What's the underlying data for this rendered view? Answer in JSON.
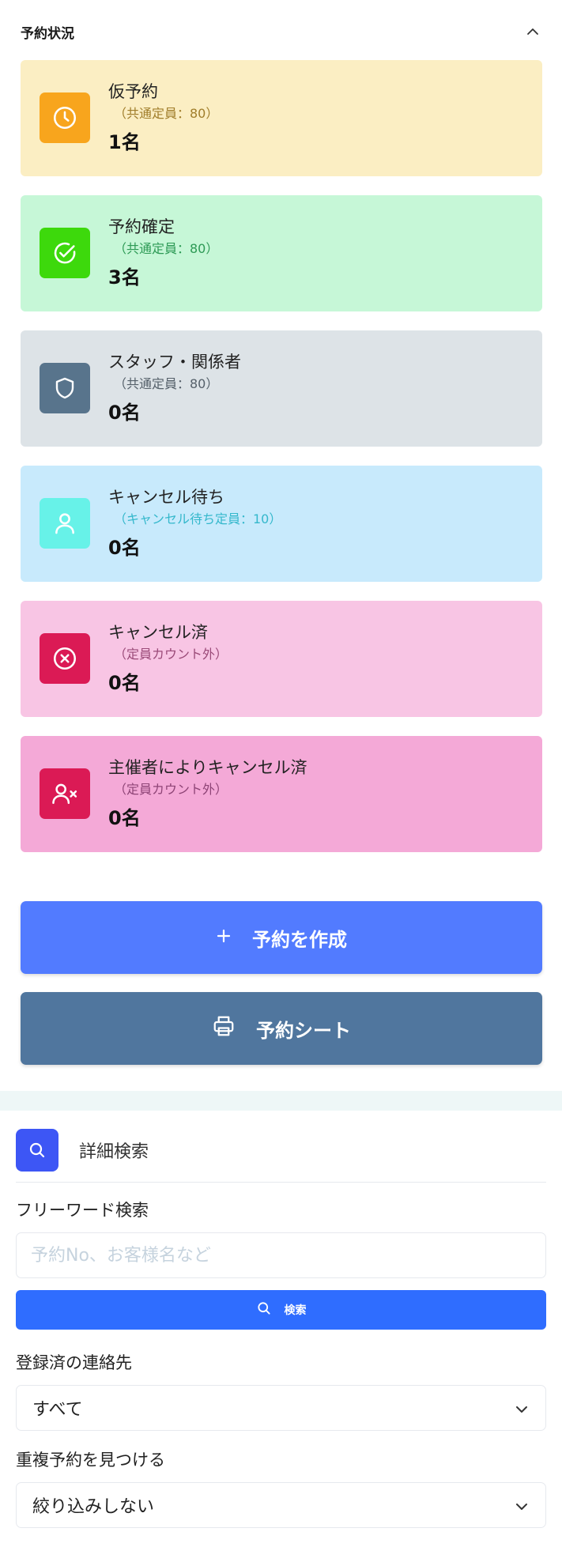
{
  "status_panel": {
    "title": "予約状況",
    "cards": [
      {
        "title": "仮予約",
        "subtitle": "（共通定員：80）",
        "count": "1名",
        "icon": "clock-icon",
        "bg": "#fbeec3",
        "icon_bg": "#f8a51d",
        "sub_color": "#a07d2a"
      },
      {
        "title": "予約確定",
        "subtitle": "（共通定員：80）",
        "count": "3名",
        "icon": "check-circle-icon",
        "bg": "#c6f7d7",
        "icon_bg": "#3dd90c",
        "sub_color": "#2d9a55"
      },
      {
        "title": "スタッフ・関係者",
        "subtitle": "（共通定員：80）",
        "count": "0名",
        "icon": "shield-icon",
        "bg": "#dde3e7",
        "icon_bg": "#58748c",
        "sub_color": "#55606a"
      },
      {
        "title": "キャンセル待ち",
        "subtitle": "（キャンセル待ち定員：10）",
        "count": "0名",
        "icon": "user-icon",
        "bg": "#c8eafc",
        "icon_bg": "#67f2e8",
        "sub_color": "#35b8cc"
      },
      {
        "title": "キャンセル済",
        "subtitle": "（定員カウント外）",
        "count": "0名",
        "icon": "x-circle-icon",
        "bg": "#f8c5e4",
        "icon_bg": "#db1a55",
        "sub_color": "#9a4a78"
      },
      {
        "title": "主催者によりキャンセル済",
        "subtitle": "（定員カウント外）",
        "count": "0名",
        "icon": "user-x-icon",
        "bg": "#f4a9d7",
        "icon_bg": "#db1a55",
        "sub_color": "#8e4476"
      }
    ],
    "buttons": {
      "create_label": "予約を作成",
      "sheet_label": "予約シート"
    }
  },
  "search_panel": {
    "title": "詳細検索",
    "freeword_label": "フリーワード検索",
    "freeword_value": "",
    "freeword_placeholder": "予約No、お客様名など",
    "search_button_label": "検索",
    "contact_label": "登録済の連絡先",
    "contact_value": "すべて",
    "duplicate_label": "重複予約を見つける",
    "duplicate_value": "絞り込みしない"
  }
}
